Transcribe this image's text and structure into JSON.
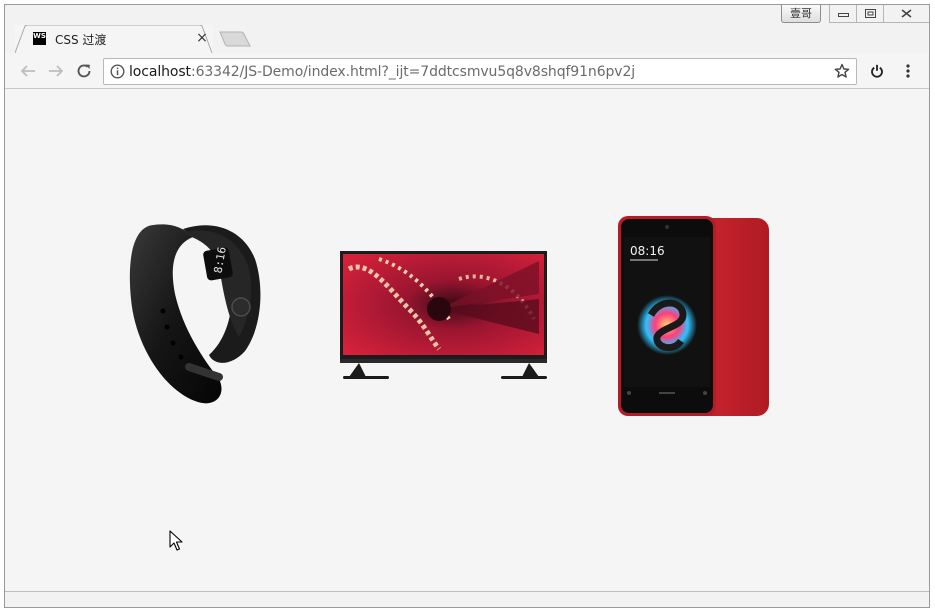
{
  "browser": {
    "profile_label": "壹哥",
    "tab": {
      "favicon_text": "WS",
      "title": "CSS 过渡",
      "close_glyph": "×"
    },
    "address_bar": {
      "url_host": "localhost",
      "url_rest": ":63342/JS-Demo/index.html?_ijt=7ddtcsmvu5q8v8shqf91n6pv2j"
    },
    "icons": {
      "back": "back-arrow-icon",
      "forward": "forward-arrow-icon",
      "reload": "reload-icon",
      "info": "info-icon",
      "bookmark": "star-icon",
      "extension": "power-icon",
      "menu": "kebab-menu-icon"
    }
  },
  "page": {
    "products": [
      {
        "name": "fitness-band-image"
      },
      {
        "name": "television-image"
      },
      {
        "name": "smartphone-image"
      }
    ],
    "phone_clock": "08:16",
    "band_clock": "8:16"
  },
  "colors": {
    "page_background": "#f5f5f5",
    "tv_screen_red": "#d6213b",
    "phone_red": "#c3222c"
  }
}
